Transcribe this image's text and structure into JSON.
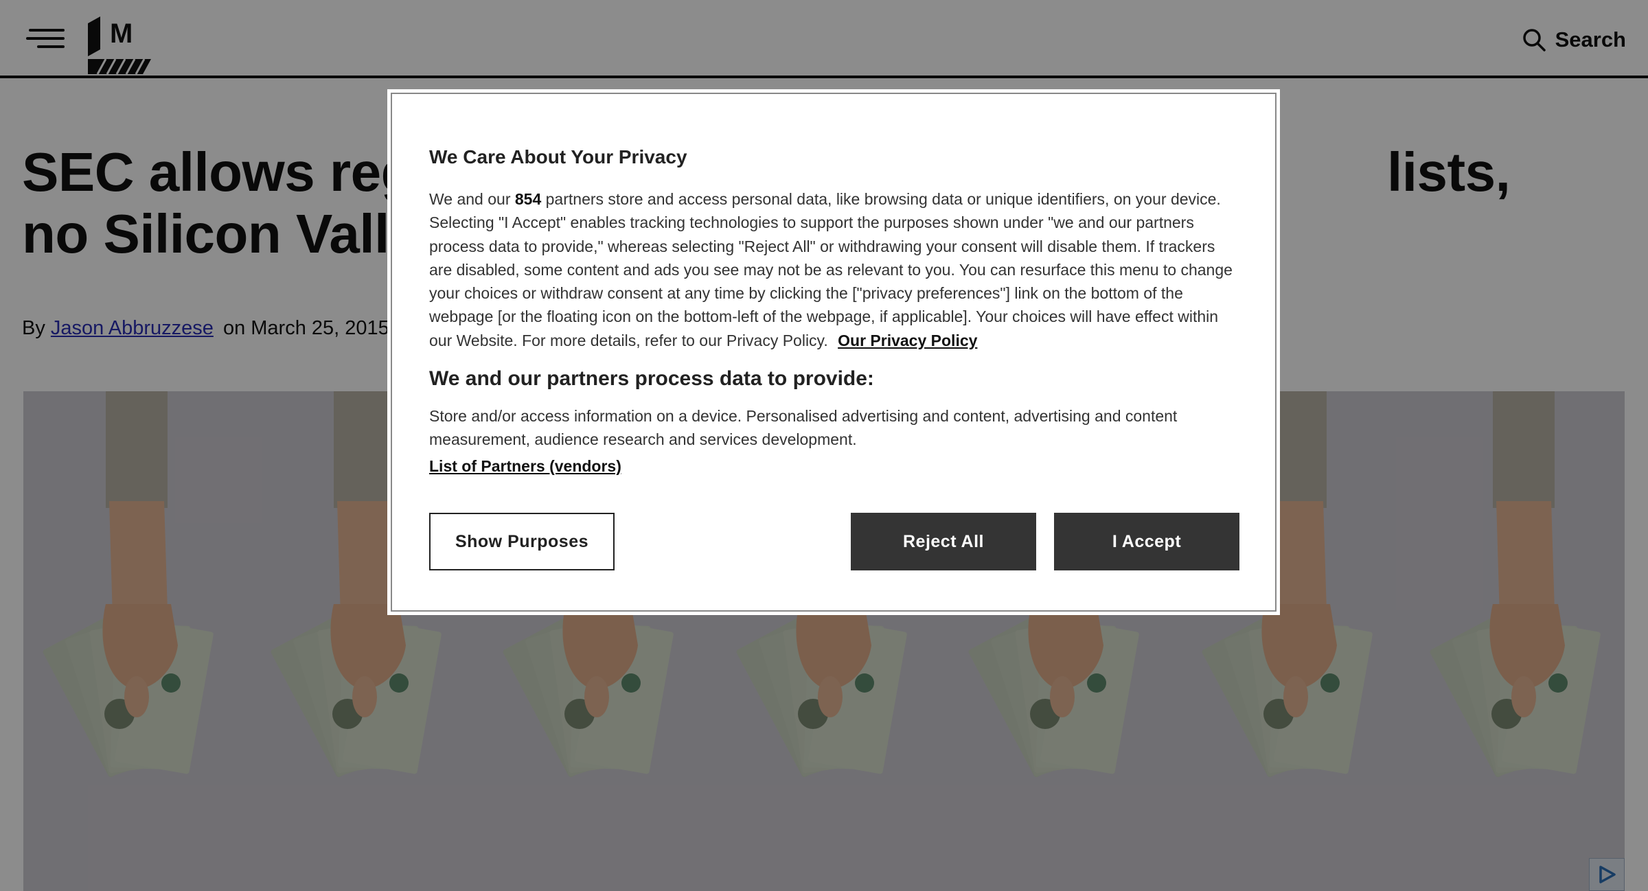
{
  "header": {
    "menu_icon": "hamburger-menu-icon",
    "logo_icon": "site-logo-icon",
    "logo_letter": "M",
    "search_label": "Search",
    "search_icon": "search-icon"
  },
  "article": {
    "headline_left_line1": "SEC allows regul",
    "headline_right_line1": "lists,",
    "headline_left_line2": "no Silicon Valley",
    "byline_prefix": "By",
    "author": "Jason Abbruzzese",
    "date_text": "on March 25, 2015",
    "hero_icon": "hands-holding-cash-image"
  },
  "consent": {
    "title": "We Care About Your Privacy",
    "body_intro": "We and our",
    "partner_count": "854",
    "body_text": "partners store and access personal data, like browsing data or unique identifiers, on your device. Selecting \"I Accept\" enables tracking technologies to support the purposes shown under \"we and our partners process data to provide,\" whereas selecting \"Reject All\" or withdrawing your consent will disable them. If trackers are disabled, some content and ads you see may not be as relevant to you. You can resurface this menu to change your choices or withdraw consent at any time by clicking the [\"privacy preferences\"] link on the bottom of the webpage [or the floating icon on the bottom-left of the webpage, if applicable]. Your choices will have effect within our Website. For more details, refer to our Privacy Policy.",
    "privacy_link": "Our Privacy Policy",
    "section_title": "We and our partners process data to provide:",
    "purposes_text": "Store and/or access information on a device. Personalised advertising and content, advertising and content measurement, audience research and services development.",
    "partners_link": "List of Partners (vendors)",
    "btn_show_purposes": "Show Purposes",
    "btn_reject": "Reject All",
    "btn_accept": "I Accept"
  },
  "ad": {
    "badge_icon": "ad-choices-icon"
  },
  "colors": {
    "link": "#2b2fb5",
    "button_dark": "#343434",
    "overlay": "rgba(0,0,0,0.45)"
  }
}
